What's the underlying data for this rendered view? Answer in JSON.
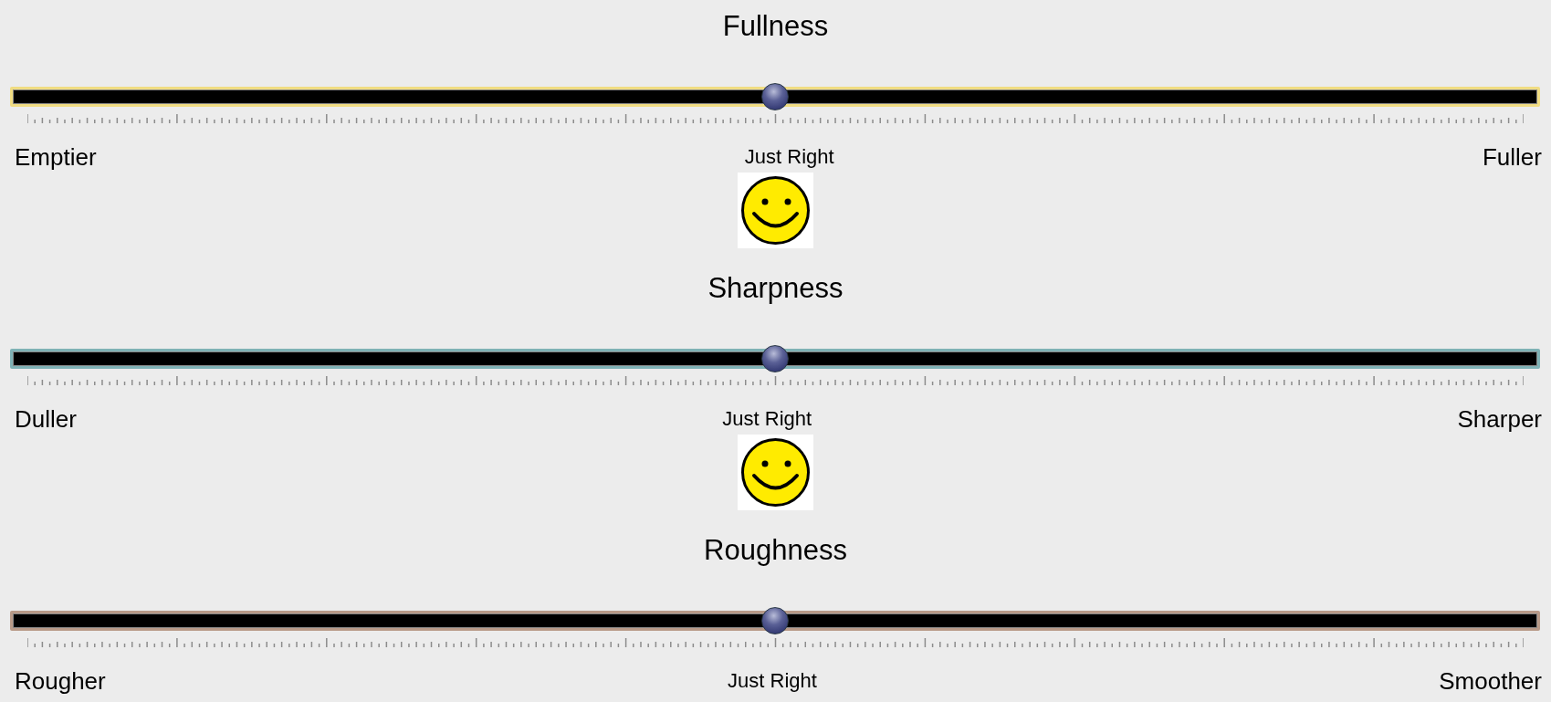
{
  "sliders": [
    {
      "title": "Fullness",
      "color": "#f0dc82",
      "level": 0.5,
      "min_label": "Emptier",
      "mid_label": "Just Right",
      "max_label": "Fuller",
      "smiley": true
    },
    {
      "title": "Sharpness",
      "color": "#7fb2b5",
      "level": 0.5,
      "min_label": "Duller",
      "mid_label": "Just Right",
      "max_label": "Sharper",
      "smiley": true
    },
    {
      "title": "Roughness",
      "color": "#b89a88",
      "level": 0.5,
      "min_label": "Rougher",
      "mid_label": "Just Right",
      "max_label": "Smoother",
      "smiley": false
    }
  ]
}
